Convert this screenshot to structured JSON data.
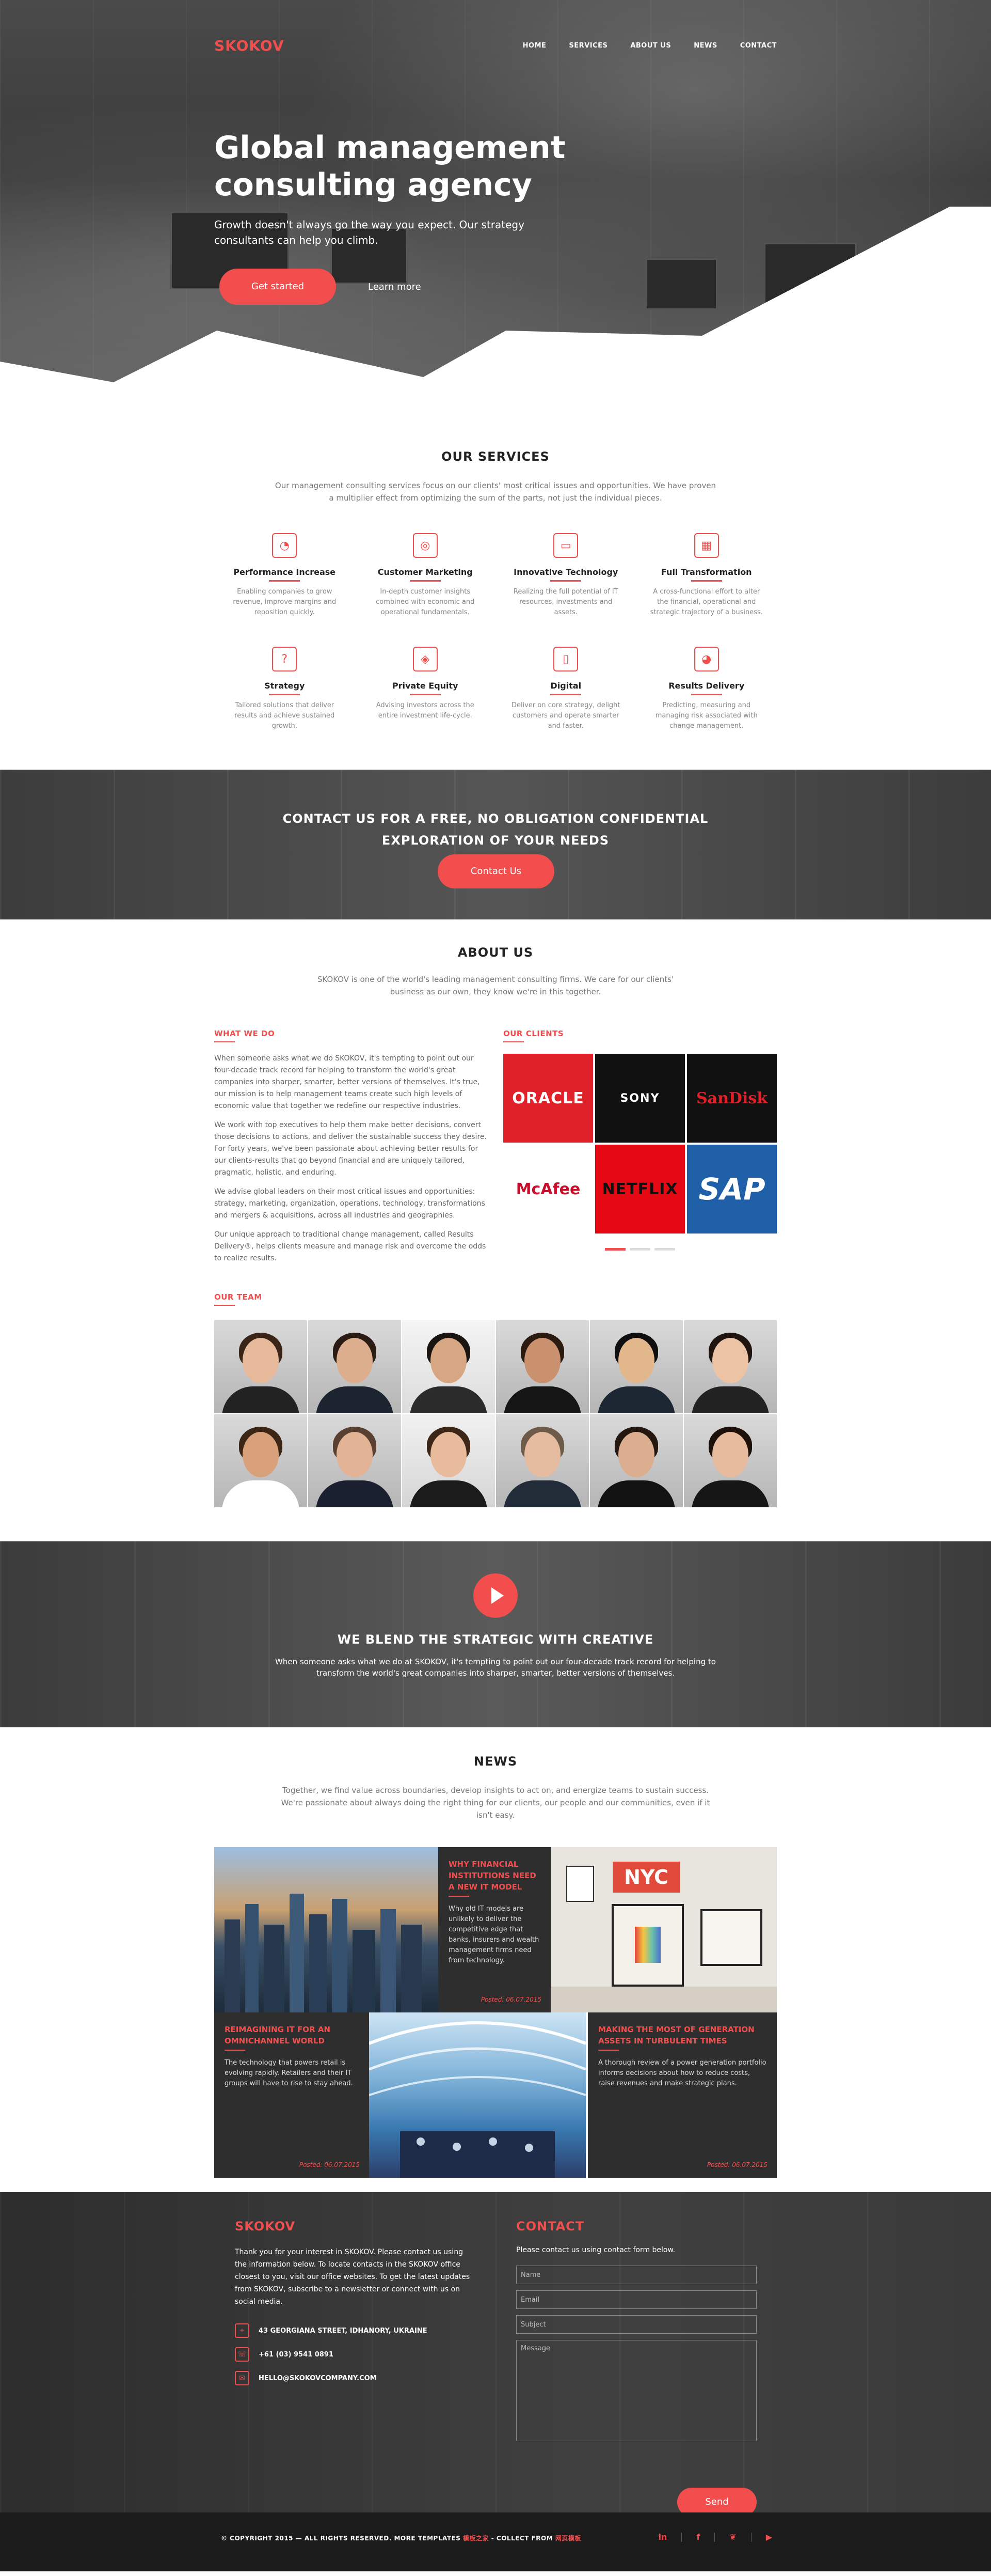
{
  "brand": {
    "name": "SKOKOV"
  },
  "nav": [
    "HOME",
    "SERVICES",
    "ABOUT US",
    "NEWS",
    "CONTACT"
  ],
  "hero": {
    "title": "Global management consulting agency",
    "subtitle": "Growth doesn't always go the way you expect. Our strategy consultants can help you climb.",
    "primary_button": "Get started",
    "secondary_button": "Learn more"
  },
  "services": {
    "title": "OUR SERVICES",
    "intro": "Our management consulting services focus on our clients' most critical issues and opportunities. We have proven a multiplier effect from optimizing the sum of the parts, not just the individual pieces.",
    "items": [
      {
        "title": "Performance Increase",
        "text": "Enabling companies to grow revenue, improve margins and reposition quickly.",
        "icon": "chart-icon"
      },
      {
        "title": "Customer Marketing",
        "text": "In-depth customer insights combined with economic and operational fundamentals.",
        "icon": "target-icon"
      },
      {
        "title": "Innovative Technology",
        "text": "Realizing the full potential of IT resources, investments and assets.",
        "icon": "monitor-icon"
      },
      {
        "title": "Full Transformation",
        "text": "A cross-functional effort to alter the financial, operational and strategic trajectory of a business.",
        "icon": "bars-icon"
      },
      {
        "title": "Strategy",
        "text": "Tailored solutions that deliver results and achieve sustained growth.",
        "icon": "question-icon"
      },
      {
        "title": "Private Equity",
        "text": "Advising investors across the entire investment life-cycle.",
        "icon": "tag-icon"
      },
      {
        "title": "Digital",
        "text": "Deliver on core strategy, delight customers and operate smarter and faster.",
        "icon": "phone-icon"
      },
      {
        "title": "Results Delivery",
        "text": "Predicting, measuring and managing risk associated with change management.",
        "icon": "pie-icon"
      }
    ]
  },
  "cta": {
    "title_line1": "CONTACT US FOR A FREE, NO OBLIGATION CONFIDENTIAL",
    "title_line2": "EXPLORATION OF YOUR NEEDS",
    "button": "Contact Us"
  },
  "about": {
    "title": "ABOUT US",
    "intro": "SKOKOV is one of the world's leading management consulting firms. We care for our clients' business as our own, they know we're in this together.",
    "what_we_do_title": "WHAT WE DO",
    "paragraphs": [
      "When someone asks what we do SKOKOV, it's tempting to point out our four-decade track record for helping to transform the world's great companies into sharper, smarter, better versions of themselves. It's true, our mission is to help management teams create such high levels of economic value that together we redefine our respective industries.",
      "We work with top executives to help them make better decisions, convert those decisions to actions, and deliver the sustainable success they desire. For forty years, we've been passionate about achieving better results for our clients-results that go beyond financial and are uniquely tailored, pragmatic, holistic, and enduring.",
      "We advise global leaders on their most critical issues and opportunities: strategy, marketing, organization, operations, technology, transformations and mergers & acquisitions, across all industries and geographies.",
      "Our unique approach to traditional change management, called Results Delivery®, helps clients measure and manage risk and overcome the odds to realize results."
    ],
    "clients_title": "OUR CLIENTS",
    "clients": [
      {
        "name": "ORACLE",
        "bg": "#e02129",
        "fg": "#ffffff"
      },
      {
        "name": "SONY",
        "bg": "#111111",
        "fg": "#ffffff"
      },
      {
        "name": "SanDisk",
        "bg": "#111111",
        "fg": "#e02129"
      },
      {
        "name": "McAfee",
        "bg": "#ffffff",
        "fg": "#c8102e"
      },
      {
        "name": "NETFLIX",
        "bg": "#e50914",
        "fg": "#111111"
      },
      {
        "name": "SAP",
        "bg": "#1f5fa8",
        "fg": "#ffffff"
      }
    ],
    "team_title": "OUR TEAM"
  },
  "blend": {
    "title": "WE BLEND THE STRATEGIC WITH CREATIVE",
    "text": "When someone asks what we do at SKOKOV, it's tempting to point out our four-decade track record for helping to transform the world's great companies into sharper, smarter, better versions of themselves."
  },
  "news": {
    "title": "NEWS",
    "intro": "Together, we find value across boundaries, develop insights to act on, and energize teams to sustain success. We're passionate about always doing the right thing for our clients, our people and our communities, even if it isn't easy.",
    "items": [
      {
        "title": "WHY FINANCIAL INSTITUTIONS NEED A NEW IT MODEL",
        "text": "Why old IT models are unlikely to deliver the competitive edge that banks, insurers and wealth management firms need from technology.",
        "date": "Posted: 06.07.2015"
      },
      {
        "title": "REIMAGINING IT FOR AN OMNICHANNEL WORLD",
        "text": "The technology that powers retail is evolving rapidly. Retailers and their IT groups will have to rise to stay ahead.",
        "date": "Posted: 06.07.2015"
      },
      {
        "title": "MAKING THE MOST OF GENERATION ASSETS IN TURBULENT TIMES",
        "text": "A thorough review of a power generation portfolio informs decisions about how to reduce costs, raise revenues and make strategic plans.",
        "date": "Posted: 06.07.2015"
      }
    ],
    "poster_text": "NYC"
  },
  "contact": {
    "brand": "SKOKOV",
    "intro": "Thank you for your interest in SKOKOV. Please contact us using the information below. To locate contacts in the SKOKOV office closest to you, visit our office websites. To get the latest updates from SKOKOV, subscribe to a newsletter or connect with us on social media.",
    "address": "43 GEORGIANA STREET, IDHANORY, UKRAINE",
    "phone": "+61 (03) 9541 0891",
    "email": "HELLO@SKOKOVCOMPANY.COM",
    "form_title": "CONTACT",
    "form_intro": "Please contact us using contact form below.",
    "name_placeholder": "Name",
    "email_placeholder": "Email",
    "subject_placeholder": "Subject",
    "message_placeholder": "Message",
    "send": "Send"
  },
  "footer": {
    "copyright_prefix": "© COPYRIGHT 2015 — ALL RIGHTS RESERVED. MORE TEMPLATES",
    "link1": "模板之家",
    "middle": "- COLLECT FROM",
    "link2": "网页模板",
    "social": [
      "in",
      "f",
      "❦",
      "▶"
    ]
  }
}
